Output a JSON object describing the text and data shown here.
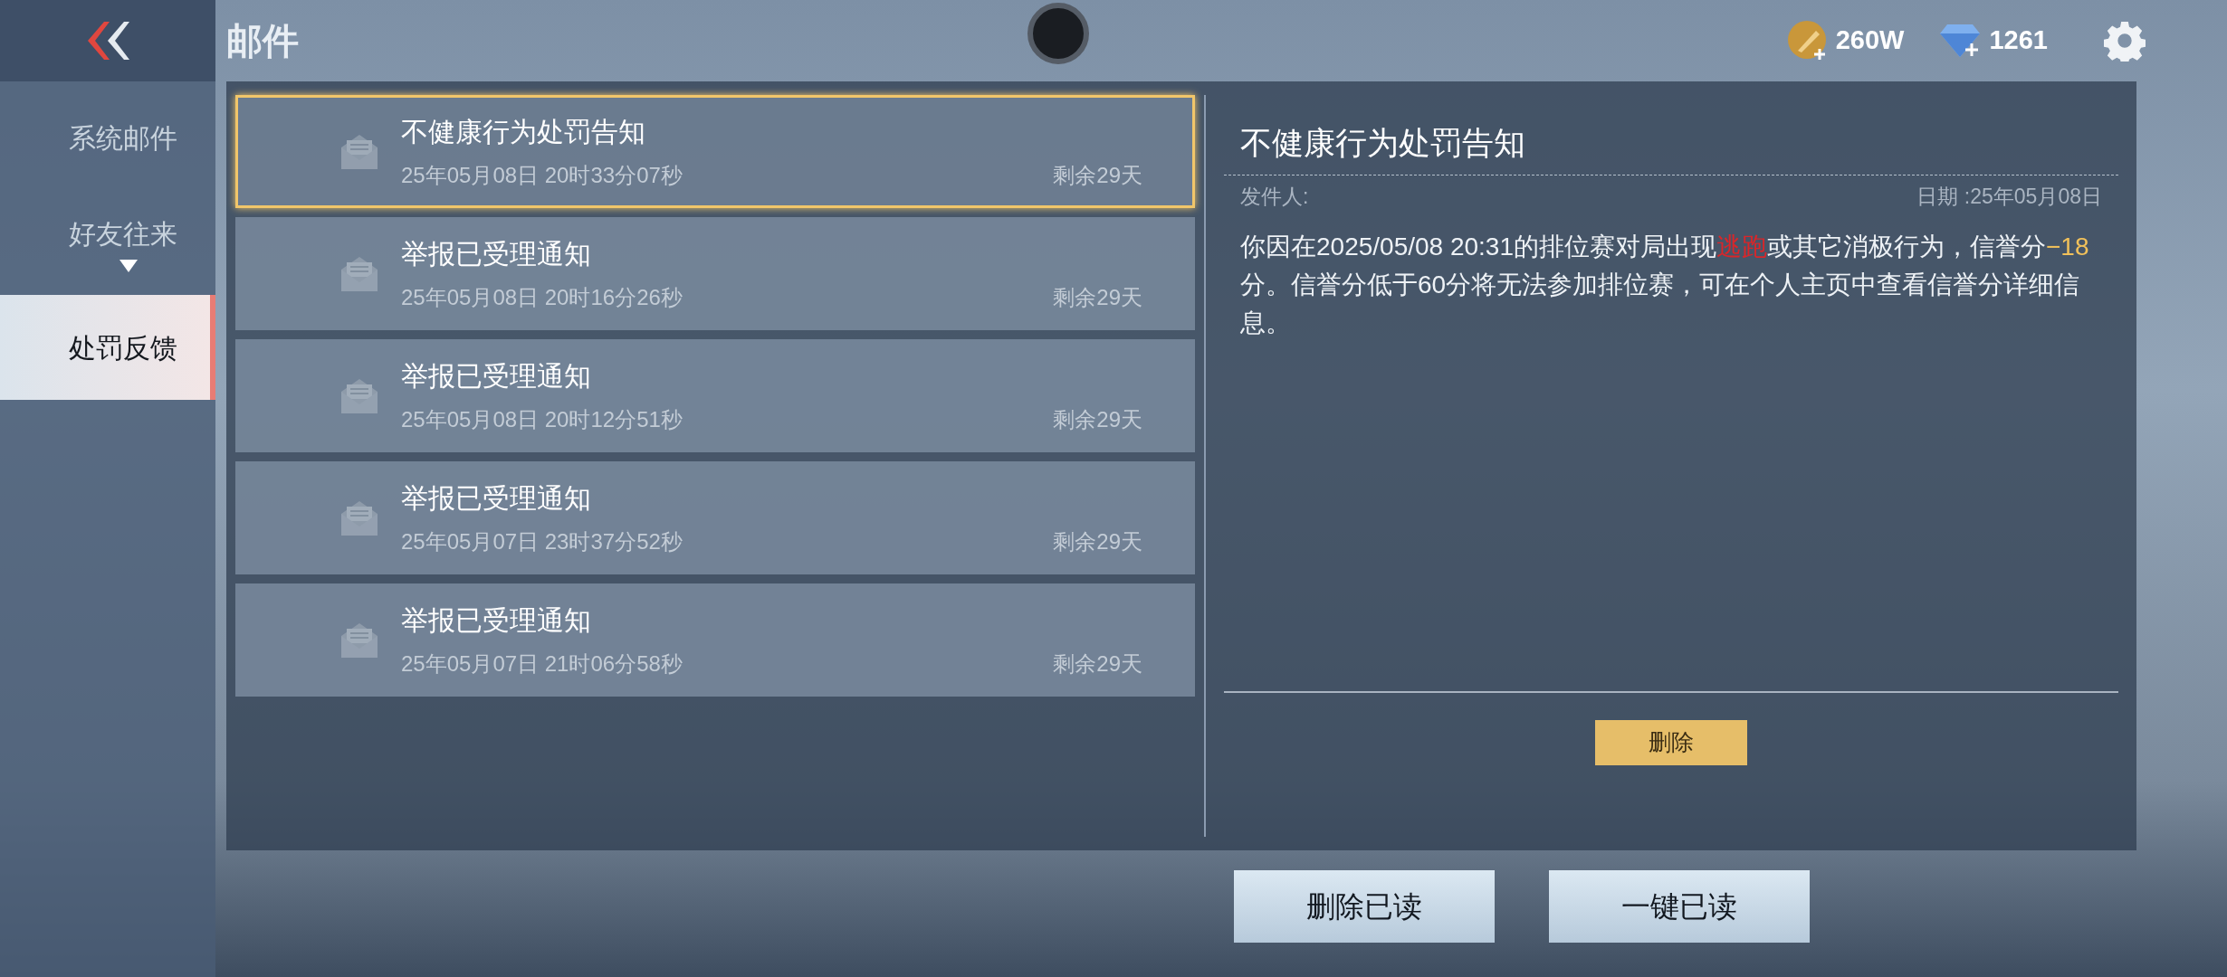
{
  "header": {
    "title": "邮件",
    "currencies": [
      {
        "kind": "coin",
        "amount": "260W"
      },
      {
        "kind": "diamond",
        "amount": "1261"
      }
    ]
  },
  "sidebar": {
    "tabs": [
      {
        "label": "系统邮件",
        "selected": false,
        "kind": "plain"
      },
      {
        "label": "好友往来",
        "selected": false,
        "kind": "dropdown"
      },
      {
        "label": "处罚反馈",
        "selected": true,
        "kind": "plain"
      }
    ]
  },
  "mail_list": [
    {
      "title": "不健康行为处罚告知",
      "time": "25年05月08日 20时33分07秒",
      "remaining": "剩余29天",
      "selected": true
    },
    {
      "title": "举报已受理通知",
      "time": "25年05月08日 20时16分26秒",
      "remaining": "剩余29天",
      "selected": false
    },
    {
      "title": "举报已受理通知",
      "time": "25年05月08日 20时12分51秒",
      "remaining": "剩余29天",
      "selected": false
    },
    {
      "title": "举报已受理通知",
      "time": "25年05月07日 23时37分52秒",
      "remaining": "剩余29天",
      "selected": false
    },
    {
      "title": "举报已受理通知",
      "time": "25年05月07日 21时06分58秒",
      "remaining": "剩余29天",
      "selected": false
    }
  ],
  "detail": {
    "title": "不健康行为处罚告知",
    "sender_label": "发件人:",
    "date": "日期 :25年05月08日",
    "body": [
      {
        "kind": "plain",
        "text": "你因在2025/05/08 20:31的排位赛对局出现"
      },
      {
        "kind": "danger",
        "text": "逃跑"
      },
      {
        "kind": "plain",
        "text": "或其它消极行为，信誉分"
      },
      {
        "kind": "highlight",
        "text": "−18"
      },
      {
        "kind": "plain",
        "text": "分。信誉分低于60分将无法参加排位赛，可在个人主页中查看信誉分详细信息。"
      }
    ],
    "delete_button": "删除"
  },
  "footer_buttons": [
    "删除已读",
    "一键已读"
  ]
}
